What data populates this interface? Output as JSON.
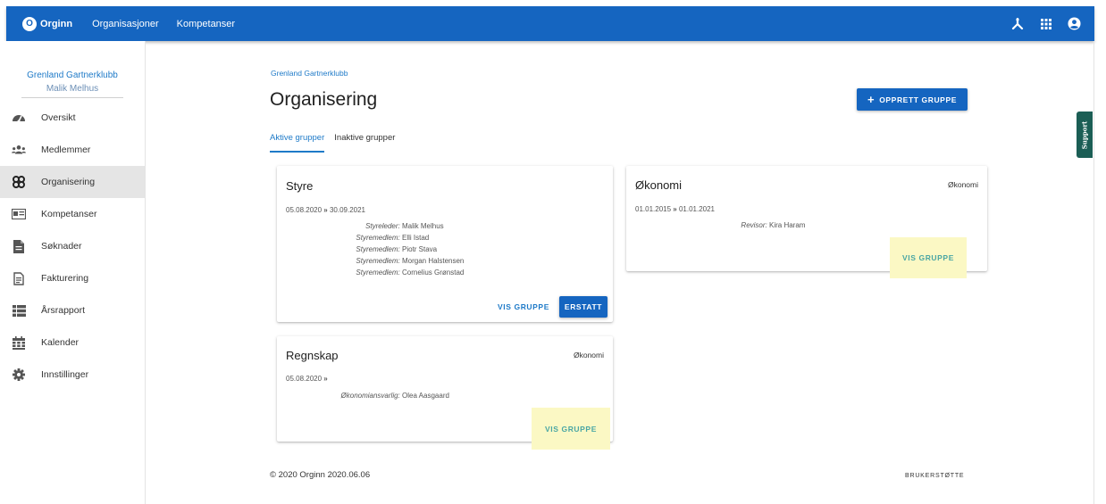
{
  "appbar": {
    "logo_letter": "O",
    "brand": "Orginn",
    "nav": [
      "Organisasjoner",
      "Kompetanser"
    ],
    "icons": [
      "hierarchy-icon",
      "apps-grid-icon",
      "account-circle-icon"
    ],
    "color": "#1565c0"
  },
  "sidebar": {
    "org_name": "Grenland Gartnerklubb",
    "user_name": "Malik Melhus",
    "items": [
      {
        "label": "Oversikt",
        "icon": "speedometer-icon",
        "active": false
      },
      {
        "label": "Medlemmer",
        "icon": "people-icon",
        "active": false
      },
      {
        "label": "Organisering",
        "icon": "organization-icon",
        "active": true
      },
      {
        "label": "Kompetanser",
        "icon": "id-card-icon",
        "active": false
      },
      {
        "label": "Søknader",
        "icon": "document-icon",
        "active": false
      },
      {
        "label": "Fakturering",
        "icon": "invoice-icon",
        "active": false
      },
      {
        "label": "Årsrapport",
        "icon": "list-icon",
        "active": false
      },
      {
        "label": "Kalender",
        "icon": "calendar-icon",
        "active": false
      },
      {
        "label": "Innstillinger",
        "icon": "gear-icon",
        "active": false
      }
    ]
  },
  "main": {
    "breadcrumb": "Grenland Gartnerklubb",
    "title": "Organisering",
    "create_button": "OPPRETT GRUPPE",
    "tabs": [
      {
        "label": "Aktive grupper",
        "active": true
      },
      {
        "label": "Inaktive grupper",
        "active": false
      }
    ]
  },
  "cards": {
    "styre": {
      "title": "Styre",
      "category": "",
      "date_from": "05.08.2020",
      "date_to": "30.09.2021",
      "roles": [
        {
          "title": "Styreleder:",
          "name": "Malik Melhus"
        },
        {
          "title": "Styremedlem:",
          "name": "Elli Istad"
        },
        {
          "title": "Styremedlem:",
          "name": "Piotr Stava"
        },
        {
          "title": "Styremedlem:",
          "name": "Morgan Halstensen"
        },
        {
          "title": "Styremedlem:",
          "name": "Cornelius Grønstad"
        }
      ],
      "vis_button": "VIS GRUPPE",
      "replace_button": "ERSTATT"
    },
    "okonomi": {
      "title": "Økonomi",
      "category": "Økonomi",
      "date_from": "01.01.2015",
      "date_to": "01.01.2021",
      "roles": [
        {
          "title": "Revisor:",
          "name": "Kira Haram"
        }
      ],
      "vis_button": "VIS GRUPPE"
    },
    "regnskap": {
      "title": "Regnskap",
      "category": "Økonomi",
      "date_from": "05.08.2020",
      "date_to": "",
      "roles": [
        {
          "title": "Økonomiansvarlig:",
          "name": "Olea Aasgaard"
        }
      ],
      "vis_button": "VIS GRUPPE"
    }
  },
  "date_arrow": "»",
  "footer": {
    "copyright": "© 2020 Orginn 2020.06.06",
    "support_link": "BRUKERSTØTTE"
  },
  "support_tab": "Support",
  "highlight_color": "#fbf8c4"
}
